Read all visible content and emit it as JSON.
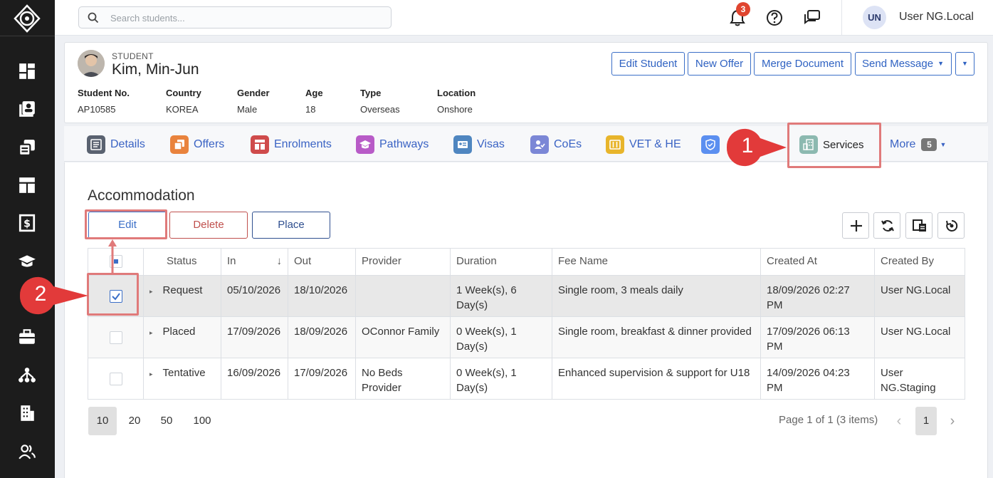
{
  "header": {
    "search_placeholder": "Search students...",
    "notification_count": "3",
    "user_initials": "UN",
    "user_name": "User NG.Local"
  },
  "student": {
    "label": "STUDENT",
    "name": "Kim, Min-Jun",
    "actions": {
      "edit": "Edit Student",
      "new_offer": "New Offer",
      "merge": "Merge Document",
      "send_message": "Send Message"
    },
    "fields": [
      {
        "key": "Student No.",
        "value": "AP10585"
      },
      {
        "key": "Country",
        "value": "KOREA"
      },
      {
        "key": "Gender",
        "value": "Male"
      },
      {
        "key": "Age",
        "value": "18"
      },
      {
        "key": "Type",
        "value": "Overseas"
      },
      {
        "key": "Location",
        "value": "Onshore"
      }
    ]
  },
  "tabs": [
    {
      "label": "Details",
      "color": "#5a6270"
    },
    {
      "label": "Offers",
      "color": "#e9833d"
    },
    {
      "label": "Enrolments",
      "color": "#cf4b4b"
    },
    {
      "label": "Pathways",
      "color": "#b85bc7"
    },
    {
      "label": "Visas",
      "color": "#4f86c0"
    },
    {
      "label": "CoEs",
      "color": "#7b87d6"
    },
    {
      "label": "VET & HE",
      "color": "#e8b52b"
    },
    {
      "label": "",
      "color": "#5b8ff0"
    },
    {
      "label": "Services",
      "color": "#8cb9b0"
    },
    {
      "label": "More",
      "badge": "5"
    }
  ],
  "section": {
    "title": "Accommodation",
    "buttons": {
      "edit": "Edit",
      "delete": "Delete",
      "place": "Place"
    }
  },
  "table": {
    "columns": [
      "Status",
      "In",
      "Out",
      "Provider",
      "Duration",
      "Fee Name",
      "Created At",
      "Created By"
    ],
    "rows": [
      {
        "status": "Request",
        "in": "05/10/2026",
        "out": "18/10/2026",
        "provider": "",
        "duration": "1 Week(s), 6 Day(s)",
        "fee": "Single room, 3 meals daily",
        "created_at": "18/09/2026 02:27 PM",
        "created_by": "User NG.Local",
        "checked": true
      },
      {
        "status": "Placed",
        "in": "17/09/2026",
        "out": "18/09/2026",
        "provider": "OConnor Family",
        "duration": "0 Week(s), 1 Day(s)",
        "fee": "Single room, breakfast & dinner provided",
        "created_at": "17/09/2026 06:13 PM",
        "created_by": "User NG.Local",
        "checked": false
      },
      {
        "status": "Tentative",
        "in": "16/09/2026",
        "out": "17/09/2026",
        "provider": "No Beds Provider",
        "duration": "0 Week(s), 1 Day(s)",
        "fee": "Enhanced supervision & support for U18",
        "created_at": "14/09/2026 04:23 PM",
        "created_by": "User NG.Staging",
        "checked": false
      }
    ]
  },
  "pager": {
    "sizes": [
      "10",
      "20",
      "50",
      "100"
    ],
    "info": "Page 1 of 1 (3 items)",
    "current": "1"
  },
  "annotations": {
    "step1": "1",
    "step2": "2",
    "color": "#e23a3a"
  }
}
